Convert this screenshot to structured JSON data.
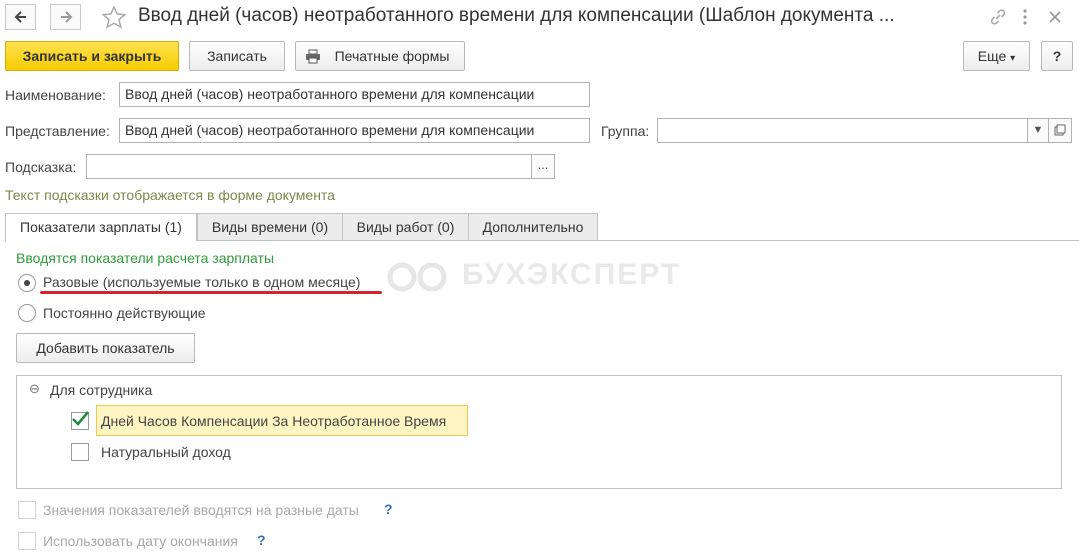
{
  "header": {
    "title": "Ввод дней (часов) неотработанного времени для компенсации (Шаблон документа ...",
    "back_icon": "arrow-left",
    "forward_icon": "arrow-right",
    "star_icon": "star",
    "link_icon": "link",
    "menu_icon": "more-vertical",
    "close_icon": "close"
  },
  "toolbar": {
    "save_close": "Записать и закрыть",
    "save": "Записать",
    "print_forms": "Печатные формы",
    "more": "Еще",
    "more_arrow": "▾",
    "help": "?"
  },
  "form": {
    "name_label": "Наименование:",
    "name_value": "Ввод дней (часов) неотработанного времени для компенсации",
    "presentation_label": "Представление:",
    "presentation_value": "Ввод дней (часов) неотработанного времени для компенсации",
    "group_label": "Группа:",
    "group_value": "",
    "hint_label": "Подсказка:",
    "hint_value": "",
    "ellipsis": "...",
    "hint_text": "Текст подсказки отображается в форме документа"
  },
  "tabs": [
    {
      "label": "Показатели зарплаты (1)",
      "active": true
    },
    {
      "label": "Виды времени (0)",
      "active": false
    },
    {
      "label": "Виды работ (0)",
      "active": false
    },
    {
      "label": "Дополнительно",
      "active": false
    }
  ],
  "indicators": {
    "heading": "Вводятся показатели расчета зарплаты",
    "radio_one_time": "Разовые (используемые только в одном месяце)",
    "radio_permanent": "Постоянно действующие",
    "selected_radio": "one_time",
    "add_button": "Добавить показатель",
    "group_label": "Для сотрудника",
    "group_toggle": "⊖",
    "items": [
      {
        "label": "Дней Часов Компенсации За Неотработанное Время",
        "checked": true
      },
      {
        "label": "Натуральный доход",
        "checked": false
      }
    ],
    "option_dates": "Значения показателей вводятся на разные даты",
    "option_end_date": "Использовать дату окончания",
    "question": "?"
  },
  "watermark": {
    "text": "БУХЭКСПЕРТ"
  },
  "colors": {
    "primary_button": "#f5cc00",
    "hint_green": "#2e9c3a",
    "underline_red": "#d8212a",
    "selected_row": "#fff5c2"
  }
}
